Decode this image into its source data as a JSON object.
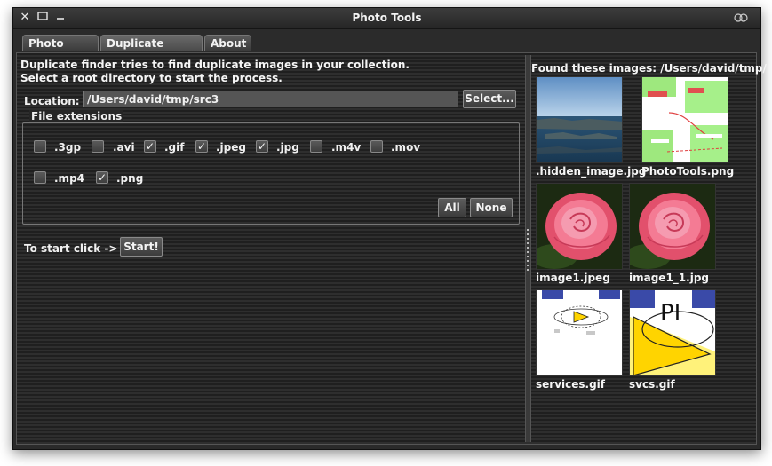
{
  "window": {
    "title": "Photo Tools"
  },
  "tabs": [
    {
      "label": "Photo Copy"
    },
    {
      "label": "Duplicate Finder"
    },
    {
      "label": "About"
    }
  ],
  "left": {
    "intro_line1": "Duplicate finder tries to find duplicate images in your collection.",
    "intro_line2": "Select a root directory to start the process.",
    "location_label": "Location:",
    "location_value": "/Users/david/tmp/src3",
    "select_button": "Select...",
    "extensions_legend": "File extensions",
    "extensions": [
      {
        "label": ".3gp",
        "checked": false
      },
      {
        "label": ".avi",
        "checked": false
      },
      {
        "label": ".gif",
        "checked": true
      },
      {
        "label": ".jpeg",
        "checked": true
      },
      {
        "label": ".jpg",
        "checked": true
      },
      {
        "label": ".m4v",
        "checked": false
      },
      {
        "label": ".mov",
        "checked": false
      },
      {
        "label": ".mp4",
        "checked": false
      },
      {
        "label": ".png",
        "checked": true
      }
    ],
    "check_mark": "✓",
    "all_button": "All",
    "none_button": "None",
    "start_label": "To start click ->",
    "start_button": "Start!"
  },
  "right": {
    "found_label": "Found these images: /Users/david/tmp/",
    "images": [
      {
        "name": ".hidden_image.jpg"
      },
      {
        "name": "PhotoTools.png"
      },
      {
        "name": "image1.jpeg"
      },
      {
        "name": "image1_1.jpg"
      },
      {
        "name": "services.gif"
      },
      {
        "name": "svcs.gif"
      }
    ]
  },
  "colors": {
    "window_bg": "#2a2a2a",
    "stripe_dark": "#1f1f1f",
    "stripe_light": "#2e2e2e"
  }
}
